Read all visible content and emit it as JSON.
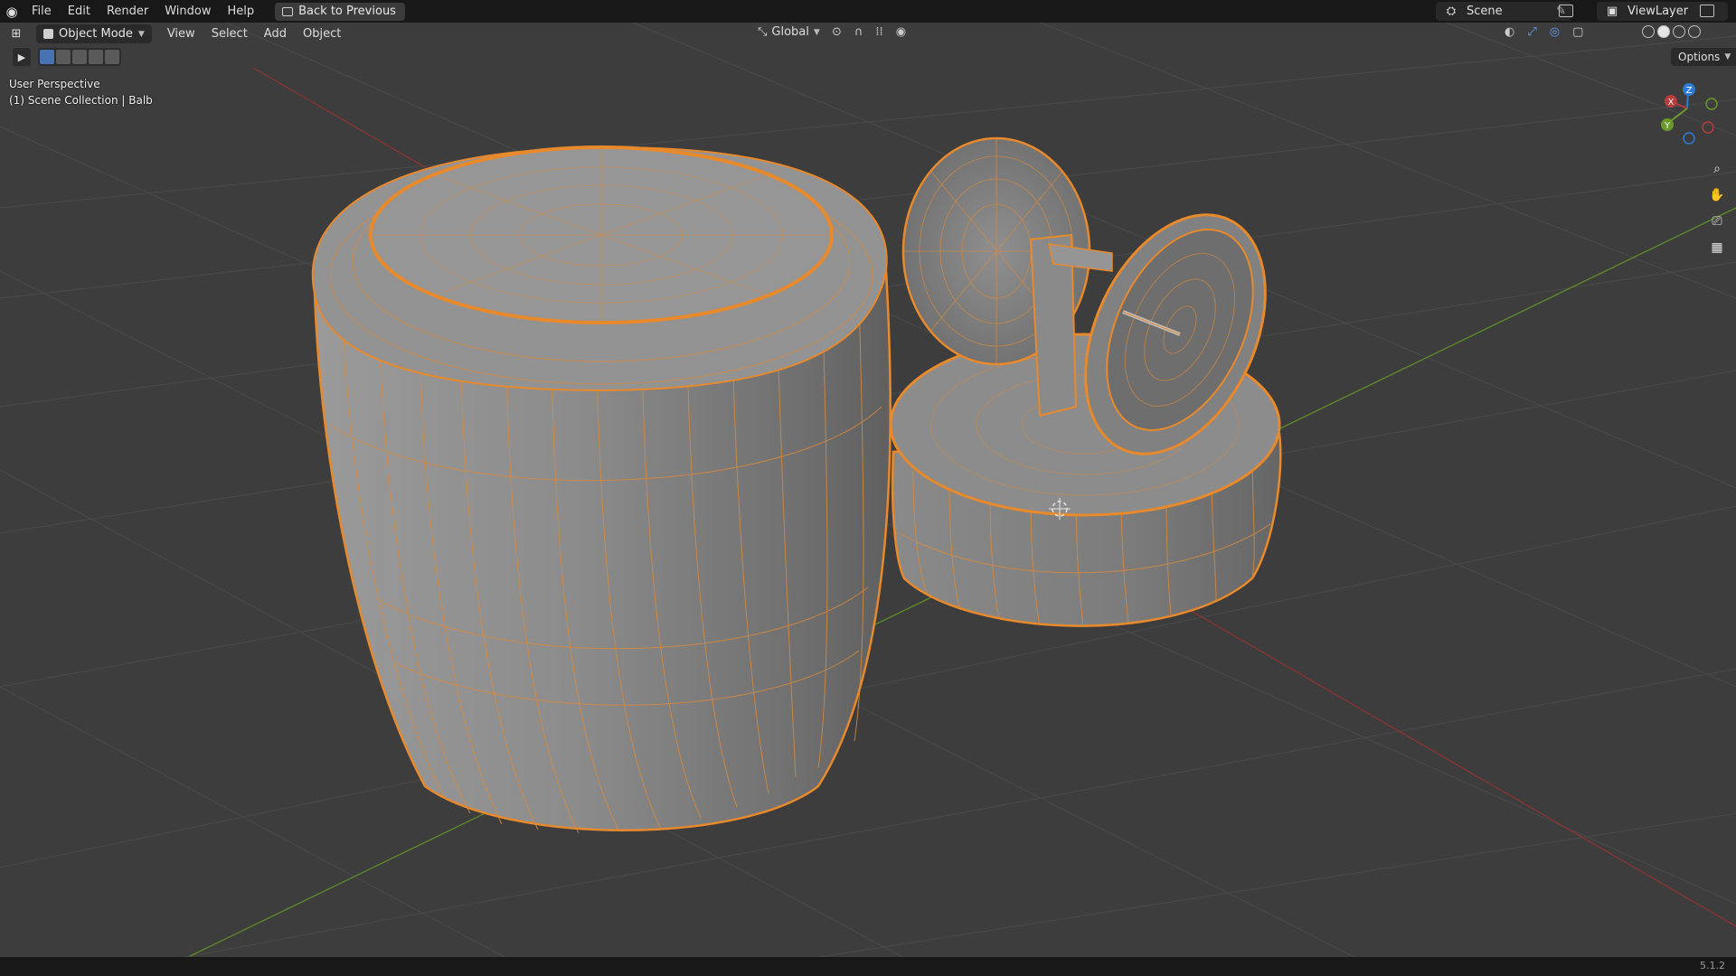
{
  "topbar": {
    "menus": [
      "File",
      "Edit",
      "Render",
      "Window",
      "Help"
    ],
    "back_button": "Back to Previous",
    "scene_name": "Scene",
    "view_layer": "ViewLayer"
  },
  "viewport_header": {
    "mode": "Object Mode",
    "menus": [
      "View",
      "Select",
      "Add",
      "Object"
    ],
    "transform_orientation": "Global",
    "options": "Options"
  },
  "overlay": {
    "perspective": "User Perspective",
    "collection": "(1) Scene Collection | Balb"
  },
  "gizmo": {
    "x": "X",
    "y": "Y",
    "z": "Z"
  },
  "status": {
    "version": "5.1.2"
  },
  "colors": {
    "selection": "#e8892c",
    "x_axis": "#b83c3c",
    "y_axis": "#6a9a2a",
    "z_axis": "#2d7bd4",
    "accent": "#4772b3"
  },
  "icons": [
    "blender-logo",
    "zoom-icon",
    "pan-hand-icon",
    "camera-icon",
    "grid-icon",
    "select-box-icon",
    "3d-cursor-icon"
  ]
}
